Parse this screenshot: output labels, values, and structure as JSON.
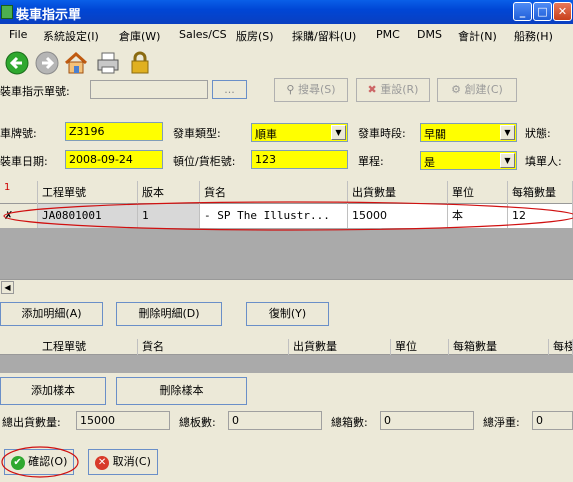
{
  "window": {
    "title": "裝車指示單",
    "min": "_",
    "max": "□",
    "close": "✕"
  },
  "menu": [
    "File",
    "系統設定(I)",
    "倉庫(W)",
    "Sales/CS",
    "版房(S)",
    "採購/留料(U)",
    "PMC",
    "DMS",
    "會計(N)",
    "船務(H)"
  ],
  "search": {
    "label": "裝車指示單號:",
    "value": "",
    "dots": "...",
    "search_btn": "搜尋(S)",
    "reset_btn": "重設(R)",
    "create_btn": "創建(C)"
  },
  "form": {
    "plate_label": "車牌號:",
    "plate": "Z3196",
    "type_label": "發車類型:",
    "type": "順車",
    "period_label": "發車時段:",
    "period": "早關",
    "status_label": "狀態:",
    "date_label": "裝車日期:",
    "date": "2008-09-24",
    "pos_label": "頓位/貨柜號:",
    "pos": "123",
    "single_label": "單程:",
    "single": "是",
    "filler_label": "填單人:"
  },
  "grid1": {
    "headers": [
      "工程單號",
      "版本",
      "貨名",
      "出貨數量",
      "單位",
      "每箱數量"
    ],
    "row_marker": "1",
    "rows": [
      {
        "marker": "✗",
        "job": "JA0801001",
        "ver": "1",
        "name": "- SP The Illustr...",
        "qty": "15000",
        "unit": "本",
        "perbox": "12"
      }
    ]
  },
  "buttons": {
    "add_detail": "添加明細(A)",
    "del_detail": "刪除明細(D)",
    "copy": "復制(Y)",
    "add_sample": "添加樣本",
    "del_sample": "刪除樣本",
    "confirm": "確認(O)",
    "cancel": "取消(C)"
  },
  "grid2": {
    "headers": [
      "工程單號",
      "貨名",
      "出貨數量",
      "單位",
      "每箱數量",
      "每棧"
    ]
  },
  "totals": {
    "qty_label": "總出貨數量:",
    "qty": "15000",
    "pallet_label": "總板數:",
    "pallet": "0",
    "box_label": "總箱數:",
    "box": "0",
    "net_label": "總淨重:",
    "net": "0"
  }
}
